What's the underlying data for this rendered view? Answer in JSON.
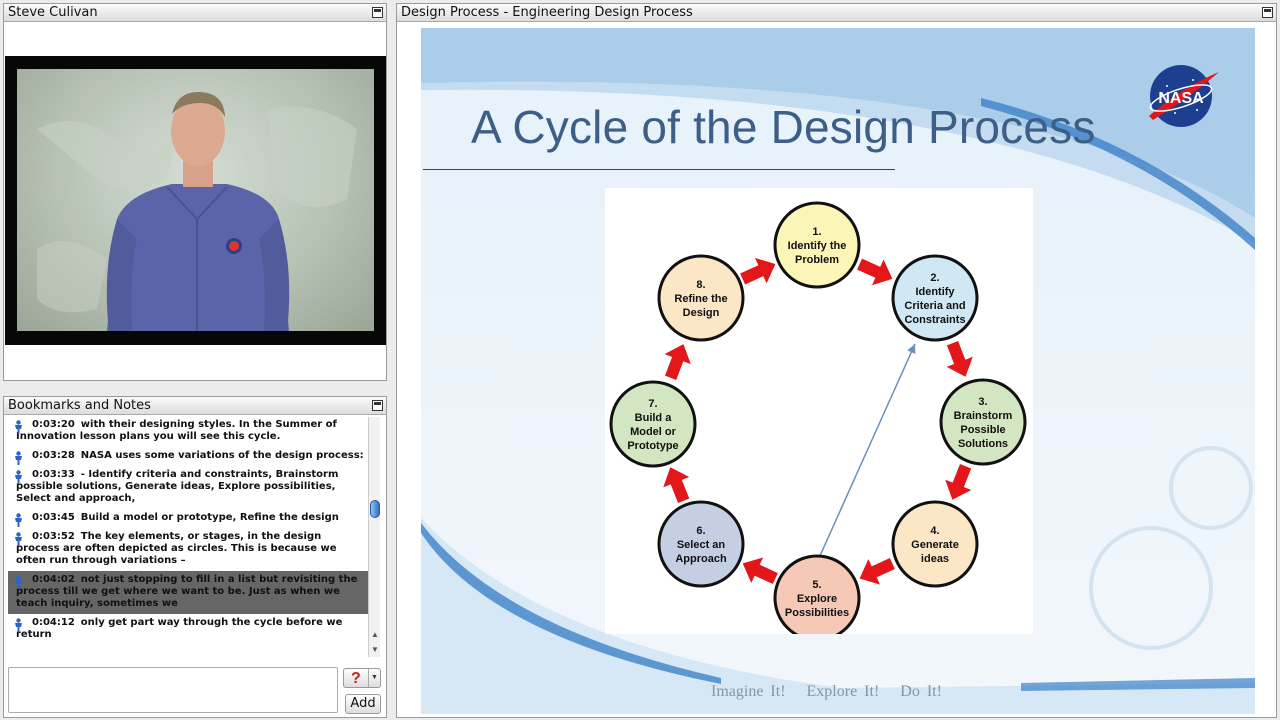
{
  "video_panel": {
    "title": "Steve Culivan"
  },
  "notes_panel": {
    "title": "Bookmarks and Notes",
    "notes": [
      {
        "time": "0:03:20",
        "text": "with their designing styles. In the Summer of Innovation lesson plans you will see this cycle.",
        "selected": false
      },
      {
        "time": "0:03:28",
        "text": "NASA uses some variations of the design process:",
        "selected": false
      },
      {
        "time": "0:03:33",
        "text": "- Identify criteria and constraints, Brainstorm possible solutions, Generate ideas, Explore possibilities, Select and approach,",
        "selected": false
      },
      {
        "time": "0:03:45",
        "text": "Build a model or prototype, Refine the design",
        "selected": false
      },
      {
        "time": "0:03:52",
        "text": "The key elements, or stages, in the design process are often depicted as circles. This is because we often run through variations –",
        "selected": false
      },
      {
        "time": "0:04:02",
        "text": "not just stopping to fill in a list but revisiting the process till we get where we want to be.  Just as when we teach inquiry, sometimes we",
        "selected": true
      },
      {
        "time": "0:04:12",
        "text": "only get part way through the cycle before we return",
        "selected": false
      }
    ],
    "help_label": "?",
    "add_label": "Add"
  },
  "slide_panel": {
    "title": "Design Process - Engineering Design Process",
    "slide_title": "A Cycle of the Design Process",
    "logo_text": "NASA",
    "tagline": [
      "Imagine It!",
      "Explore It!",
      "Do It!"
    ],
    "steps": [
      {
        "num": "1.",
        "lines": [
          "Identify the",
          "Problem"
        ],
        "color": "#fbf6b8"
      },
      {
        "num": "2.",
        "lines": [
          "Identify",
          "Criteria and",
          "Constraints"
        ],
        "color": "#cfe8f3"
      },
      {
        "num": "3.",
        "lines": [
          "Brainstorm",
          "Possible",
          "Solutions"
        ],
        "color": "#d2e7c1"
      },
      {
        "num": "4.",
        "lines": [
          "Generate",
          "ideas"
        ],
        "color": "#fbe6c6"
      },
      {
        "num": "5.",
        "lines": [
          "Explore",
          "Possibilities"
        ],
        "color": "#f6c9b7"
      },
      {
        "num": "6.",
        "lines": [
          "Select an",
          "Approach"
        ],
        "color": "#c4cfe4"
      },
      {
        "num": "7.",
        "lines": [
          "Build a",
          "Model or",
          "Prototype"
        ],
        "color": "#d2e7c1"
      },
      {
        "num": "8.",
        "lines": [
          "Refine the",
          "Design"
        ],
        "color": "#fbe6c6"
      }
    ]
  },
  "colors": {
    "arrow": "#e3161a",
    "circle_stroke": "#111111",
    "title_blue": "#3d5e86",
    "selected_row": "#666666"
  }
}
